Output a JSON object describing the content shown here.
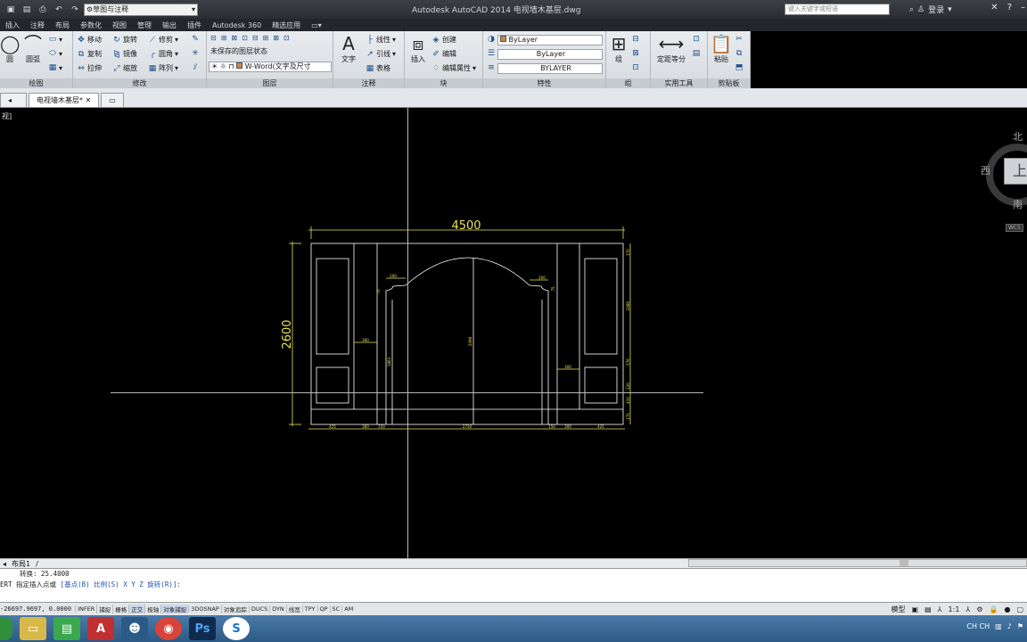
{
  "title_bar": {
    "app_title": "Autodesk AutoCAD 2014    电视墙木基层.dwg",
    "workspace": "草图与注释",
    "search_placeholder": "键入关键字或短语",
    "login_label": "登录"
  },
  "menu_tabs": [
    "插入",
    "注释",
    "布局",
    "参数化",
    "视图",
    "管理",
    "输出",
    "插件",
    "Autodesk 360",
    "精选应用"
  ],
  "ribbon": {
    "draw": {
      "circle": "圆",
      "arc": "圆弧",
      "panel_title": "绘图"
    },
    "modify": {
      "move": "移动",
      "rotate": "旋转",
      "trim": "修剪",
      "copy": "复制",
      "mirror": "镜像",
      "fillet": "圆角",
      "stretch": "拉伸",
      "scale": "缩放",
      "array": "阵列",
      "panel_title": "修改"
    },
    "layers": {
      "state": "未保存的图层状态",
      "current_layer": "W-Word(文字及尺寸",
      "panel_title": "图层"
    },
    "annotation": {
      "text": "文字",
      "linear": "线性",
      "leader": "引线",
      "table": "表格",
      "panel_title": "注释"
    },
    "block": {
      "insert": "插入",
      "create": "创建",
      "edit": "编辑",
      "edit_attr": "编辑属性",
      "panel_title": "块"
    },
    "properties": {
      "color": "ByLayer",
      "linetype": "ByLayer",
      "lineweight": "BYLAYER",
      "panel_title": "特性"
    },
    "groups": {
      "group": "组",
      "panel_title": "组"
    },
    "utilities": {
      "measure": "定距等分",
      "panel_title": "实用工具"
    },
    "clipboard": {
      "paste": "粘贴",
      "panel_title": "剪贴板"
    }
  },
  "doc_tabs": {
    "current": "电视墙木基层*"
  },
  "viewport": {
    "label": "视]",
    "viewcube": {
      "north": "北",
      "south": "南",
      "west": "西",
      "face": "上",
      "wcs": "WCS"
    }
  },
  "drawing": {
    "overall_width": "4500",
    "overall_height": "2600",
    "small_dims": {
      "top_left_block": "200",
      "top_right_block": "200",
      "left_mid": "300",
      "right_mid": "300",
      "center_height": "2098",
      "pillar_height": "1863",
      "left_bottom": [
        "425",
        "360",
        "150"
      ],
      "center_bottom": "2710",
      "right_bottom": [
        "150",
        "300",
        "425"
      ],
      "right_side": [
        "170",
        "2080",
        "576",
        "120",
        "410",
        "170"
      ],
      "left_small": "75",
      "right_small": "75"
    }
  },
  "layout_tabs": [
    "布局1"
  ],
  "command": {
    "history": "转换:    25.4000",
    "prompt_prefix": "ERT 指定插入点或 ",
    "options": "[基点(B) 比例(S) X Y Z 旋转(R)]:"
  },
  "status_bar": {
    "coords": "-26697.9697, 0.0000",
    "toggles": [
      "INFER",
      "捕捉",
      "栅格",
      "正交",
      "极轴",
      "对象捕捉",
      "3DOSNAP",
      "对象追踪",
      "DUCS",
      "DYN",
      "线宽",
      "TPY",
      "QP",
      "SC",
      "AM"
    ],
    "active_toggles": [
      "正交",
      "对象捕捉"
    ],
    "model": "模型",
    "scale": "1:1"
  },
  "taskbar": {
    "tray_text": "CH  CH"
  }
}
